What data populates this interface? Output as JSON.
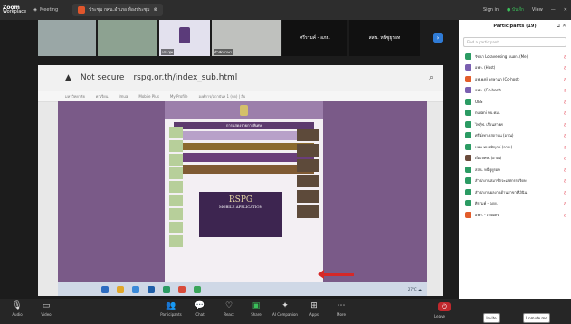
{
  "app": {
    "brand": "Zoom",
    "product": "Workplace",
    "meeting_label": "Meeting"
  },
  "topbar": {
    "share_tab": "ประชุม กศน.อำเภอ ห้องประชุม",
    "signin": "Sign in",
    "record_status": "● บันทึก",
    "view": "View"
  },
  "strip": {
    "tiles": [
      {
        "name": ""
      },
      {
        "name": ""
      },
      {
        "name": "ประชุม"
      },
      {
        "name": "สำนักงานฯ"
      },
      {
        "name": "ศรีรามค์ - อภย."
      },
      {
        "name": "สสน. หนีซูยูรอท"
      }
    ]
  },
  "browser": {
    "security": "Not secure",
    "url": "rspg.or.th/index_sub.html",
    "zoom_icon": "search-icon",
    "bookmarks": [
      "มหาวิทยาลัย",
      "ค่าเรียน",
      "Imua",
      "Mobile Plus",
      "My Profile",
      "องค์การ/สถาบันฯ 1 (จด) | สืบ"
    ]
  },
  "website": {
    "notice": "การแสดงรายการพิเศษ",
    "rspg_title": "RSPG",
    "rspg_sub": "MOBILE APPLICATION"
  },
  "taskbar": {
    "clock": "27°C ☁"
  },
  "panel": {
    "title": "Participants (19)",
    "search_placeholder": "Find a participant",
    "participants": [
      {
        "name": "รัชนา Lotaveesing อนฮก. (Me)",
        "color": "#2b9b63"
      },
      {
        "name": "อฟจ. (Host)",
        "color": "#7a5fb0"
      },
      {
        "name": "อฟ.พงษ์ ดรษาแก (Co-host)",
        "color": "#e25d2b"
      },
      {
        "name": "อฟจ. (Co-host)",
        "color": "#7a5fb0"
      },
      {
        "name": "OBS",
        "color": "#2b9b63"
      },
      {
        "name": "nurani ทบ.ค่ม.",
        "color": "#2b9b63"
      },
      {
        "name": "ไฟรู้ฟ. เรียนสายค่",
        "color": "#2b9b63"
      },
      {
        "name": "ศรีตั้งทาง สถาบน (อาณ)",
        "color": "#2b9b63"
      },
      {
        "name": "นพค ทนตุพิญุกษ์ (อาณ)",
        "color": "#2b9b63"
      },
      {
        "name": "ตั๋อสจทษ. (อาณ)",
        "color": "#6a4b3c"
      },
      {
        "name": "สสน. หนีซูยูรอท",
        "color": "#2b9b63"
      },
      {
        "name": "สำนักงานสมาชิกจะเสศกรรถริดษ",
        "color": "#2b9b63"
      },
      {
        "name": "สำนักงานผลงานด้านสาขาทีเงินิน",
        "color": "#2b9b63"
      },
      {
        "name": "ศิรามค์ - อภย.",
        "color": "#2b9b63"
      },
      {
        "name": "อฟจ. - ภาณคร",
        "color": "#e25d2b"
      }
    ]
  },
  "controls": {
    "mute": "Audio",
    "video": "Video",
    "participants": "Participants",
    "chat": "Chat",
    "react": "React",
    "share": "Share",
    "companion": "AI Companion",
    "apps": "Apps",
    "more": "More",
    "leave": "Leave",
    "invite": "Invite",
    "unmute_me": "Unmute me"
  }
}
